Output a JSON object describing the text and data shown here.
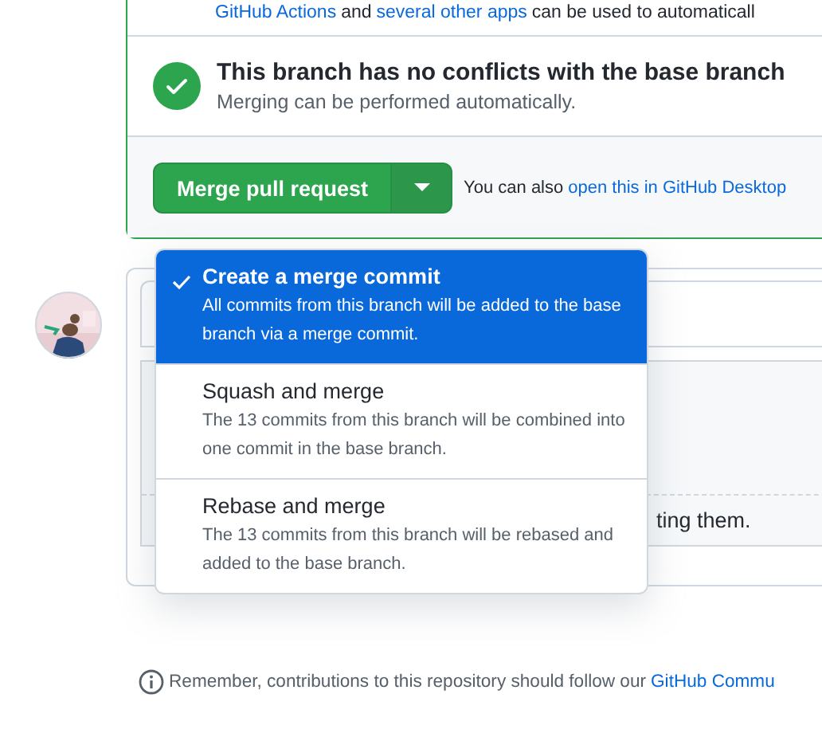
{
  "top_note": [
    {
      "kind": "link",
      "text": "GitHub Actions"
    },
    {
      "kind": "text",
      "text": "and"
    },
    {
      "kind": "link",
      "text": "several other apps"
    },
    {
      "kind": "text",
      "text": "can be used to automaticall"
    }
  ],
  "merge_status": {
    "title": "This branch has no conflicts with the base branch",
    "detail": "Merging can be performed automatically."
  },
  "merge_button": {
    "label": "Merge pull request"
  },
  "desktop_hint": {
    "text": "You can also",
    "link": "open this in GitHub Desktop"
  },
  "merge_menu": [
    {
      "title": "Create a merge commit",
      "description": "All commits from this branch will be added to the base branch via a merge commit.",
      "selected": true
    },
    {
      "title": "Squash and merge",
      "description": "The 13 commits from this branch will be combined into one commit in the base branch.",
      "selected": false
    },
    {
      "title": "Rebase and merge",
      "description": "The 13 commits from this branch will be rebased and added to the base branch.",
      "selected": false
    }
  ],
  "comment_fragment": "ting them.",
  "footer": {
    "text": "Remember, contributions to this repository should follow our",
    "link": "GitHub Commu"
  }
}
